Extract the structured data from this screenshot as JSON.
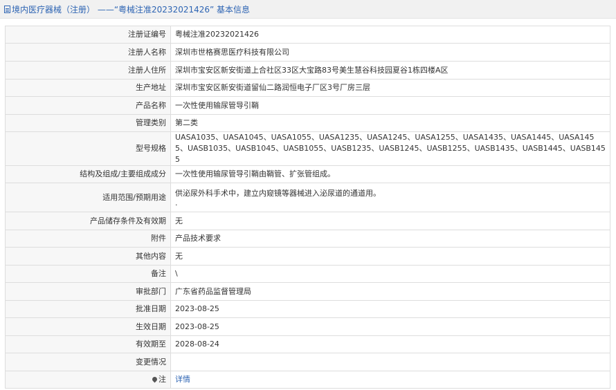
{
  "header": {
    "title": "境内医疗器械（注册） ——“粤械注准20232021426” 基本信息"
  },
  "rows": [
    {
      "label": "注册证编号",
      "value": "粤械注准20232021426"
    },
    {
      "label": "注册人名称",
      "value": "深圳市世格赛思医疗科技有限公司"
    },
    {
      "label": "注册人住所",
      "value": "深圳市宝安区新安街道上合社区33区大宝路83号美生慧谷科技园夏谷1栋四楼A区"
    },
    {
      "label": "生产地址",
      "value": "深圳市宝安区新安街道留仙二路润恒电子厂区3号厂房三层"
    },
    {
      "label": "产品名称",
      "value": "一次性使用输尿管导引鞘"
    },
    {
      "label": "管理类别",
      "value": "第二类"
    },
    {
      "label": "型号规格",
      "value": "UASA1035、UASA1045、UASA1055、UASA1235、UASA1245、UASA1255、UASA1435、UASA1445、UASA1455、UASB1035、UASB1045、UASB1055、UASB1235、UASB1245、UASB1255、UASB1435、UASB1445、UASB1455"
    },
    {
      "label": "结构及组成/主要组成成分",
      "value": "一次性使用输尿管导引鞘由鞘管、扩张管组成。"
    },
    {
      "label": "适用范围/预期用途",
      "value": "供泌尿外科手术中，建立内窥镜等器械进入泌尿道的通道用。",
      "extra": "."
    },
    {
      "label": "产品储存条件及有效期",
      "value": "无"
    },
    {
      "label": "附件",
      "value": "产品技术要求"
    },
    {
      "label": "其他内容",
      "value": "无"
    },
    {
      "label": "备注",
      "value": "\\"
    },
    {
      "label": "审批部门",
      "value": "广东省药品监督管理局"
    },
    {
      "label": "批准日期",
      "value": "2023-08-25"
    },
    {
      "label": "生效日期",
      "value": "2023-08-25"
    },
    {
      "label": "有效期至",
      "value": "2028-08-24"
    },
    {
      "label": "变更情况",
      "value": ""
    },
    {
      "label": "注",
      "value": "详情"
    }
  ],
  "colors": {
    "link": "#2d64b3",
    "label_bg": "#f7f7f7",
    "border": "#dddddd"
  },
  "icons": [
    "document-icon",
    "pin-icon"
  ]
}
